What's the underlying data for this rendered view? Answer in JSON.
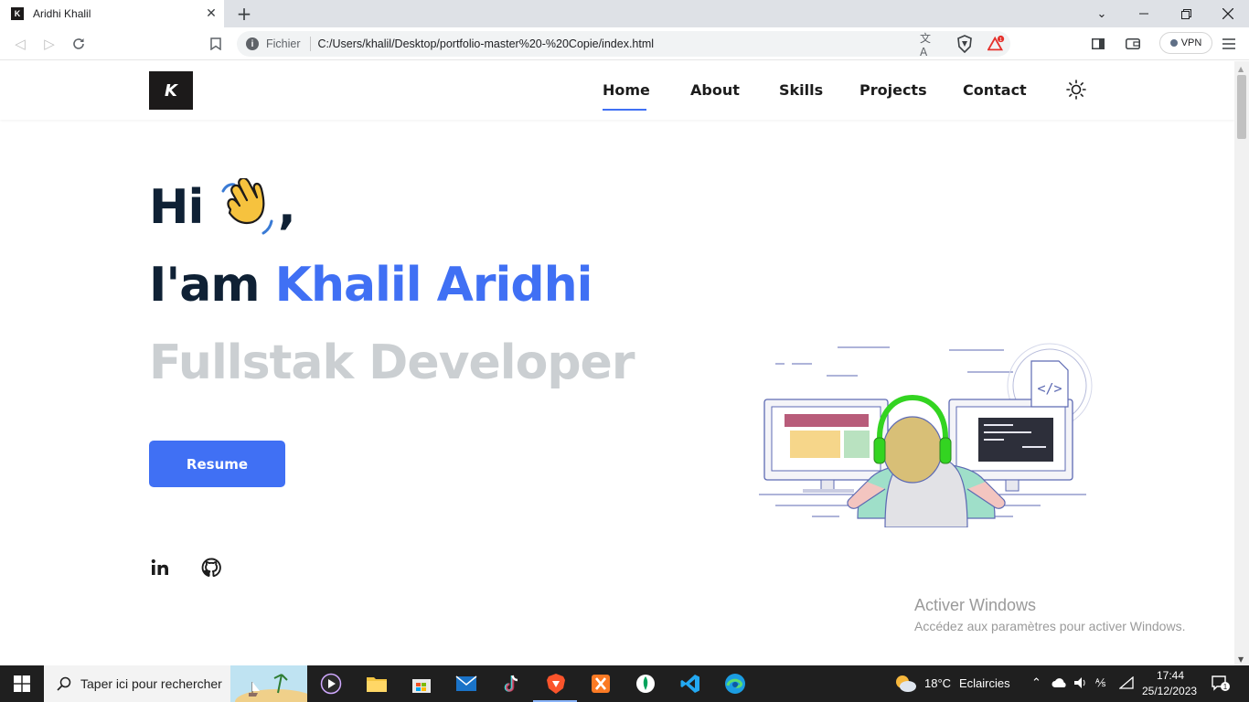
{
  "browser": {
    "tab_title": "Aridhi Khalil",
    "tab_favicon_letter": "K",
    "url_scheme_label": "Fichier",
    "url": "C:/Users/khalil/Desktop/portfolio-master%20-%20Copie/index.html",
    "vpn_label": "VPN",
    "notification_count": "1"
  },
  "site": {
    "logo_letter": "K",
    "nav": [
      {
        "label": "Home",
        "active": true
      },
      {
        "label": "About"
      },
      {
        "label": "Skills"
      },
      {
        "label": "Projects"
      },
      {
        "label": "Contact"
      }
    ],
    "theme_toggle_icon": "sun-icon"
  },
  "hero": {
    "greeting": "Hi",
    "greeting_emoji": "waving-hand-icon",
    "comma": ",",
    "iam_prefix": "I'am ",
    "name": "Khalil Aridhi",
    "role": "Fullstak Developer",
    "resume_label": "Resume",
    "accent_color": "#4070f4",
    "social": [
      "linkedin-icon",
      "github-icon"
    ]
  },
  "watermark": {
    "title": "Activer Windows",
    "subtitle": "Accédez aux paramètres pour activer Windows."
  },
  "taskbar": {
    "search_placeholder": "Taper ici pour rechercher",
    "weather_temp": "18°C",
    "weather_text": "Eclaircies",
    "time": "17:44",
    "date": "25/12/2023",
    "notifications": "1"
  }
}
